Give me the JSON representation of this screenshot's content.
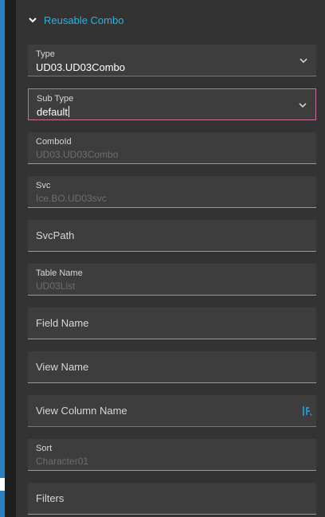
{
  "section": {
    "title": "Reusable Combo"
  },
  "fields": {
    "type": {
      "label": "Type",
      "value": "UD03.UD03Combo"
    },
    "sub_type": {
      "label": "Sub Type",
      "value": "default"
    },
    "combo_id": {
      "label": "ComboId",
      "value": "UD03.UD03Combo"
    },
    "svc": {
      "label": "Svc",
      "value": "Ice.BO.UD03svc"
    },
    "svc_path": {
      "label": "SvcPath"
    },
    "table_name": {
      "label": "Table Name",
      "value": "UD03List"
    },
    "field_name": {
      "label": "Field Name"
    },
    "view_name": {
      "label": "View Name"
    },
    "view_column_name": {
      "label": "View Column Name"
    },
    "sort": {
      "label": "Sort",
      "value": "Character01"
    },
    "filters": {
      "label": "Filters"
    }
  },
  "icons": {
    "section_toggle": "chevron-down-icon",
    "dropdown": "chevron-down-icon",
    "edit": "binding-edit-icon"
  },
  "colors": {
    "accent": "#21b5e8",
    "focus_border": "#c4709a",
    "active_underline": "#2a8fc9",
    "panel_bg": "#333333",
    "field_bg": "#3d3d3d"
  }
}
